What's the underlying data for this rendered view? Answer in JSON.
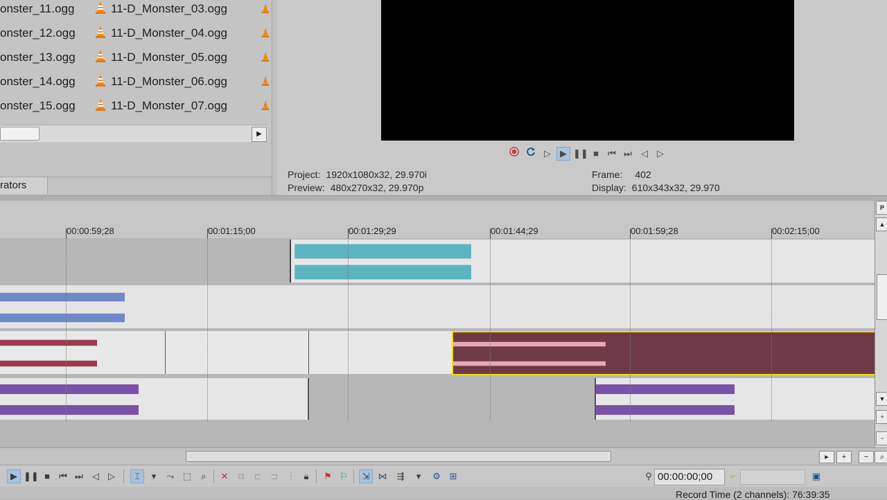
{
  "explorer": {
    "files_left": [
      "onster_11.ogg",
      "onster_12.ogg",
      "onster_13.ogg",
      "onster_14.ogg",
      "onster_15.ogg"
    ],
    "files_right": [
      "11-D_Monster_03.ogg",
      "11-D_Monster_04.ogg",
      "11-D_Monster_05.ogg",
      "11-D_Monster_06.ogg",
      "11-D_Monster_07.ogg"
    ],
    "tab_label": "rators"
  },
  "preview": {
    "project_label": "Project:",
    "project_value": "1920x1080x32, 29.970i",
    "preview_label": "Preview:",
    "preview_value": "480x270x32, 29.970p",
    "frame_label": "Frame:",
    "frame_value": "402",
    "display_label": "Display:",
    "display_value": "610x343x32, 29.970"
  },
  "ruler": {
    "labels": [
      "00:00:59;28",
      "00:01:15;00",
      "00:01:29;29",
      "00:01:44;29",
      "00:01:59;28",
      "00:02:15;00"
    ]
  },
  "toolbar": {
    "timecode": "00:00:00;00"
  },
  "status": {
    "record_time": "Record Time (2 channels): 76:39:35"
  },
  "colors": {
    "track1": "#5bb4c0",
    "track2": "#6f88c8",
    "track3": "#9a3a4c",
    "track3_selected": "#e9a8b5",
    "track4": "#7a52a8",
    "selection_border": "#f0e000"
  },
  "icons": {
    "file": "vlc-cone-icon"
  }
}
